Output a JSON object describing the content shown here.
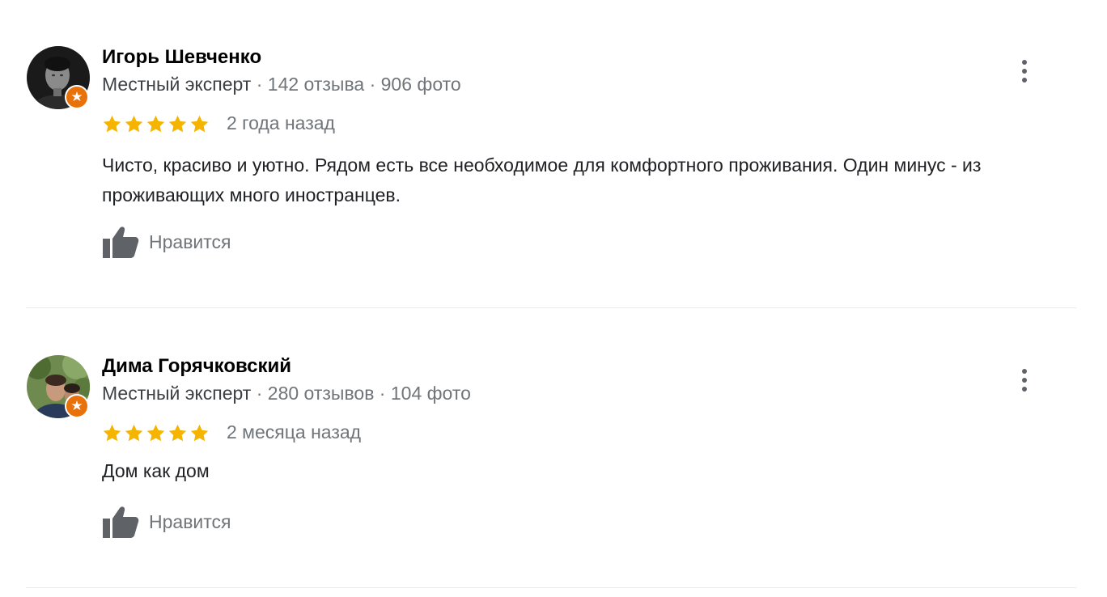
{
  "reviews": [
    {
      "name": "Игорь Шевченко",
      "expert_label": "Местный эксперт",
      "stats": " · 142 отзыва · 906 фото",
      "rating": 5,
      "date": "2 года назад",
      "text": "Чисто, красиво и уютно. Рядом есть все необходимое для комфортного проживания. Один минус - из проживающих много иностранцев.",
      "like_label": "Нравится",
      "avatar_icon": "avatar-photo-icon",
      "badge_icon": "local-guide-badge-icon"
    },
    {
      "name": "Дима Горячковский",
      "expert_label": "Местный эксперт",
      "stats": " · 280 отзывов · 104 фото",
      "rating": 5,
      "date": "2 месяца назад",
      "text": "Дом как дом",
      "like_label": "Нравится",
      "avatar_icon": "avatar-photo-icon",
      "badge_icon": "local-guide-badge-icon"
    }
  ],
  "colors": {
    "star": "#f4b400",
    "badge": "#e8710a",
    "secondary_text": "#70757a",
    "icon": "#5f6368",
    "divider": "#e8eaed"
  }
}
